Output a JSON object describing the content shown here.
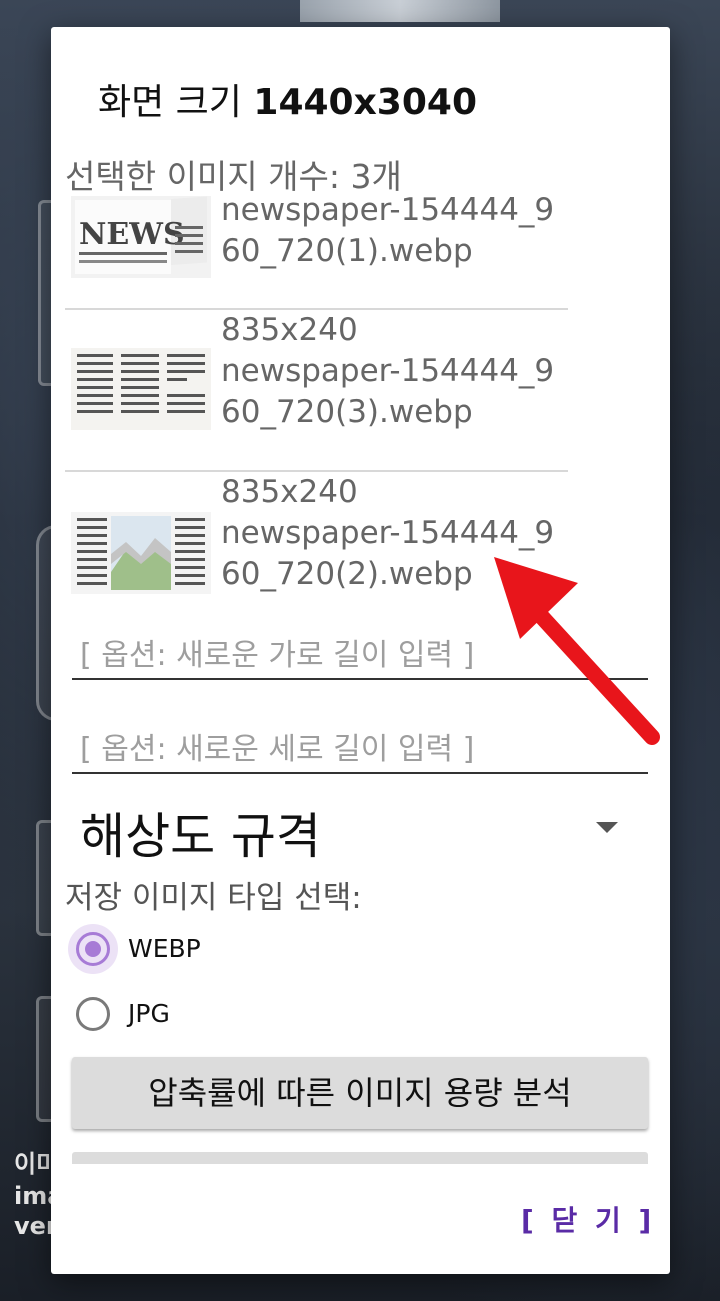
{
  "dialog": {
    "title_prefix": "화면 크기",
    "title_resolution": "1440x3040",
    "selected_count": "선택한 이미지 개수: 3개",
    "files": [
      {
        "line1": "newspaper-154444_9",
        "line2": "60_720(1).webp"
      },
      {
        "size": "835x240",
        "line1": "newspaper-154444_9",
        "line2": "60_720(3).webp"
      },
      {
        "size": "835x240",
        "line1": "newspaper-154444_9",
        "line2": "60_720(2).webp"
      }
    ],
    "width_placeholder": "[ 옵션: 새로운 가로 길이 입력 ]",
    "height_placeholder": "[ 옵션: 새로운 세로 길이 입력 ]",
    "resolution_spinner": "해상도 규격",
    "save_type_label": "저장 이미지 타입 선택:",
    "radio_webp": "WEBP",
    "radio_jpg": "JPG",
    "selected_format": "WEBP",
    "analyze_button": "압축률에 따른 이미지 용량 분석",
    "close_button": "[ 닫 기 ]"
  },
  "background": {
    "text_lines": [
      "이미",
      "ima",
      "ver"
    ]
  },
  "colors": {
    "accent": "#a77bd6",
    "close": "#5a2ba6",
    "annotation_arrow": "#e8151b"
  },
  "icons": {
    "spinner": "triangle-down-icon",
    "annotation": "red-arrow-icon"
  }
}
